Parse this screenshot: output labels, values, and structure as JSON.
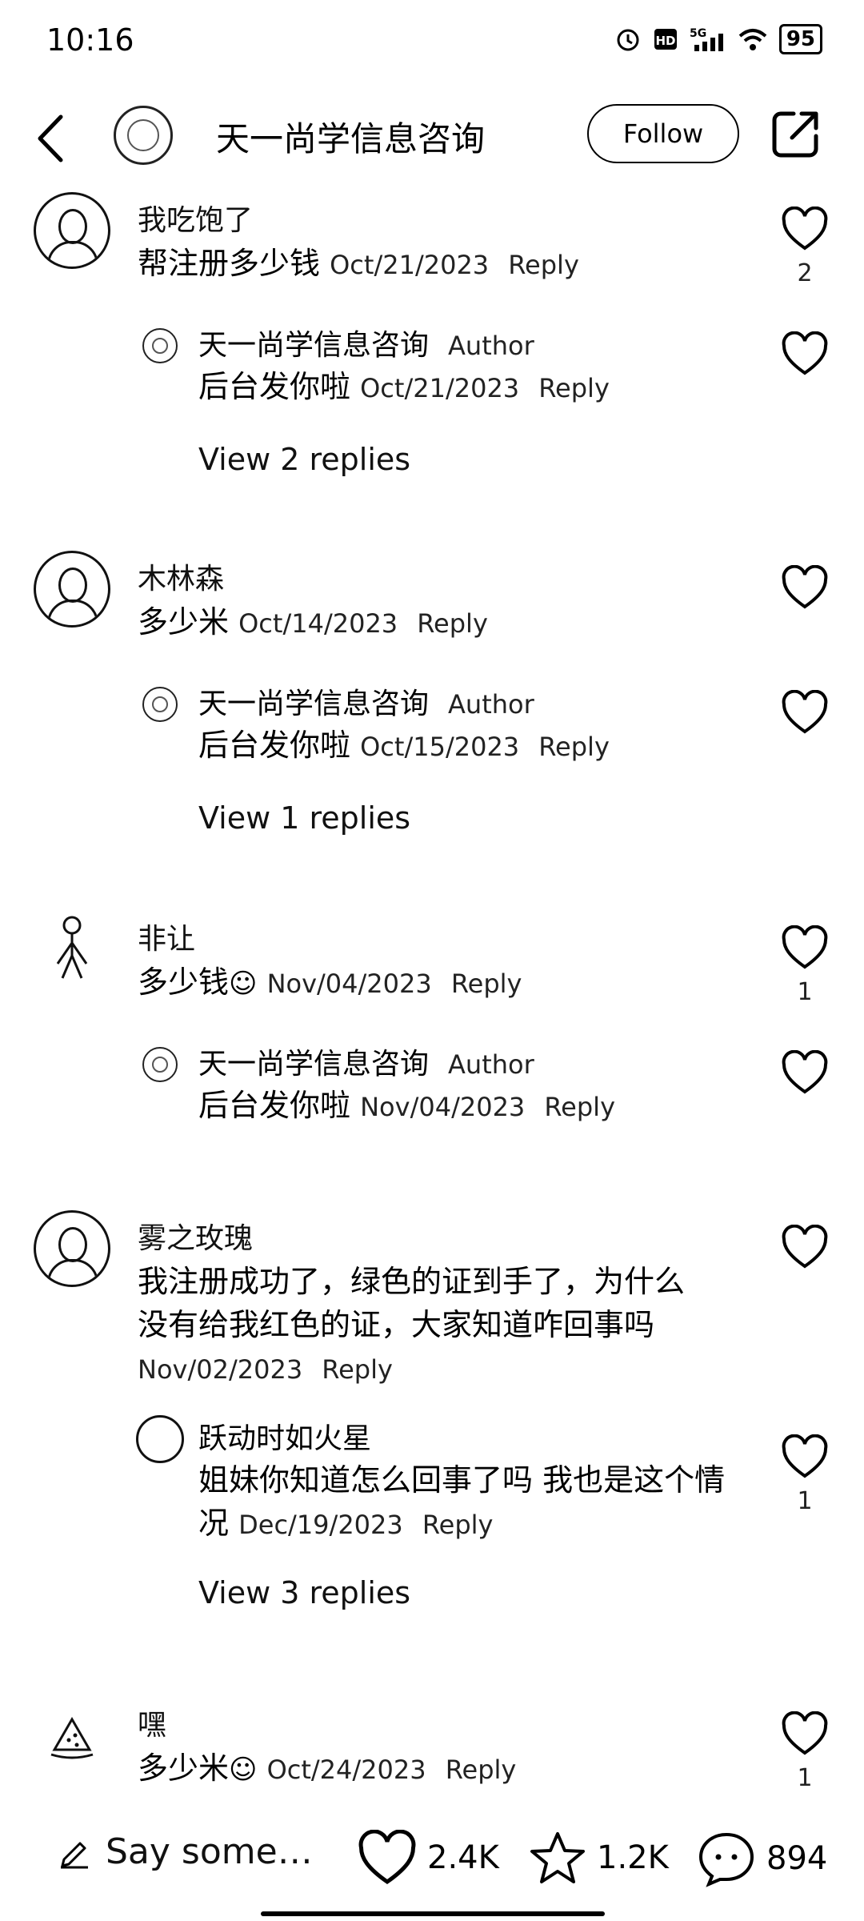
{
  "status": {
    "time": "10:16",
    "battery": "95"
  },
  "header": {
    "title": "天一尚学信息咨询",
    "follow_label": "Follow"
  },
  "comments": [
    {
      "name": "我吃饱了",
      "text": "帮注册多少钱",
      "date": "Oct/21/2023",
      "reply": "Reply",
      "likes": "2",
      "sub": {
        "name": "天一尚学信息咨询",
        "tag": "Author",
        "text": "后台发你啦",
        "date": "Oct/21/2023",
        "reply": "Reply"
      },
      "view_replies": "View 2 replies"
    },
    {
      "name": "木林森",
      "text": "多少米",
      "date": "Oct/14/2023",
      "reply": "Reply",
      "likes": "",
      "sub": {
        "name": "天一尚学信息咨询",
        "tag": "Author",
        "text": "后台发你啦",
        "date": "Oct/15/2023",
        "reply": "Reply"
      },
      "view_replies": "View 1 replies"
    },
    {
      "name": "非让",
      "text": "多少钱",
      "date": "Nov/04/2023",
      "reply": "Reply",
      "likes": "1",
      "sub": {
        "name": "天一尚学信息咨询",
        "tag": "Author",
        "text": "后台发你啦",
        "date": "Nov/04/2023",
        "reply": "Reply"
      },
      "view_replies": ""
    },
    {
      "name": "雾之玫瑰",
      "text": "我注册成功了，绿色的证到手了，为什么没有给我红色的证，大家知道咋回事吗",
      "date": "Nov/02/2023",
      "reply": "Reply",
      "likes": "",
      "sub": {
        "name": "跃动时如火星",
        "tag": "",
        "text": "姐妹你知道怎么回事了吗 我也是这个情况",
        "date": "Dec/19/2023",
        "reply": "Reply",
        "likes": "1"
      },
      "view_replies": "View 3 replies"
    },
    {
      "name": "嘿",
      "text": "多少米",
      "date": "Oct/24/2023",
      "reply": "Reply",
      "likes": "1"
    }
  ],
  "bottom": {
    "placeholder": "Say some…",
    "likes": "2.4K",
    "favorites": "1.2K",
    "comments": "894"
  }
}
